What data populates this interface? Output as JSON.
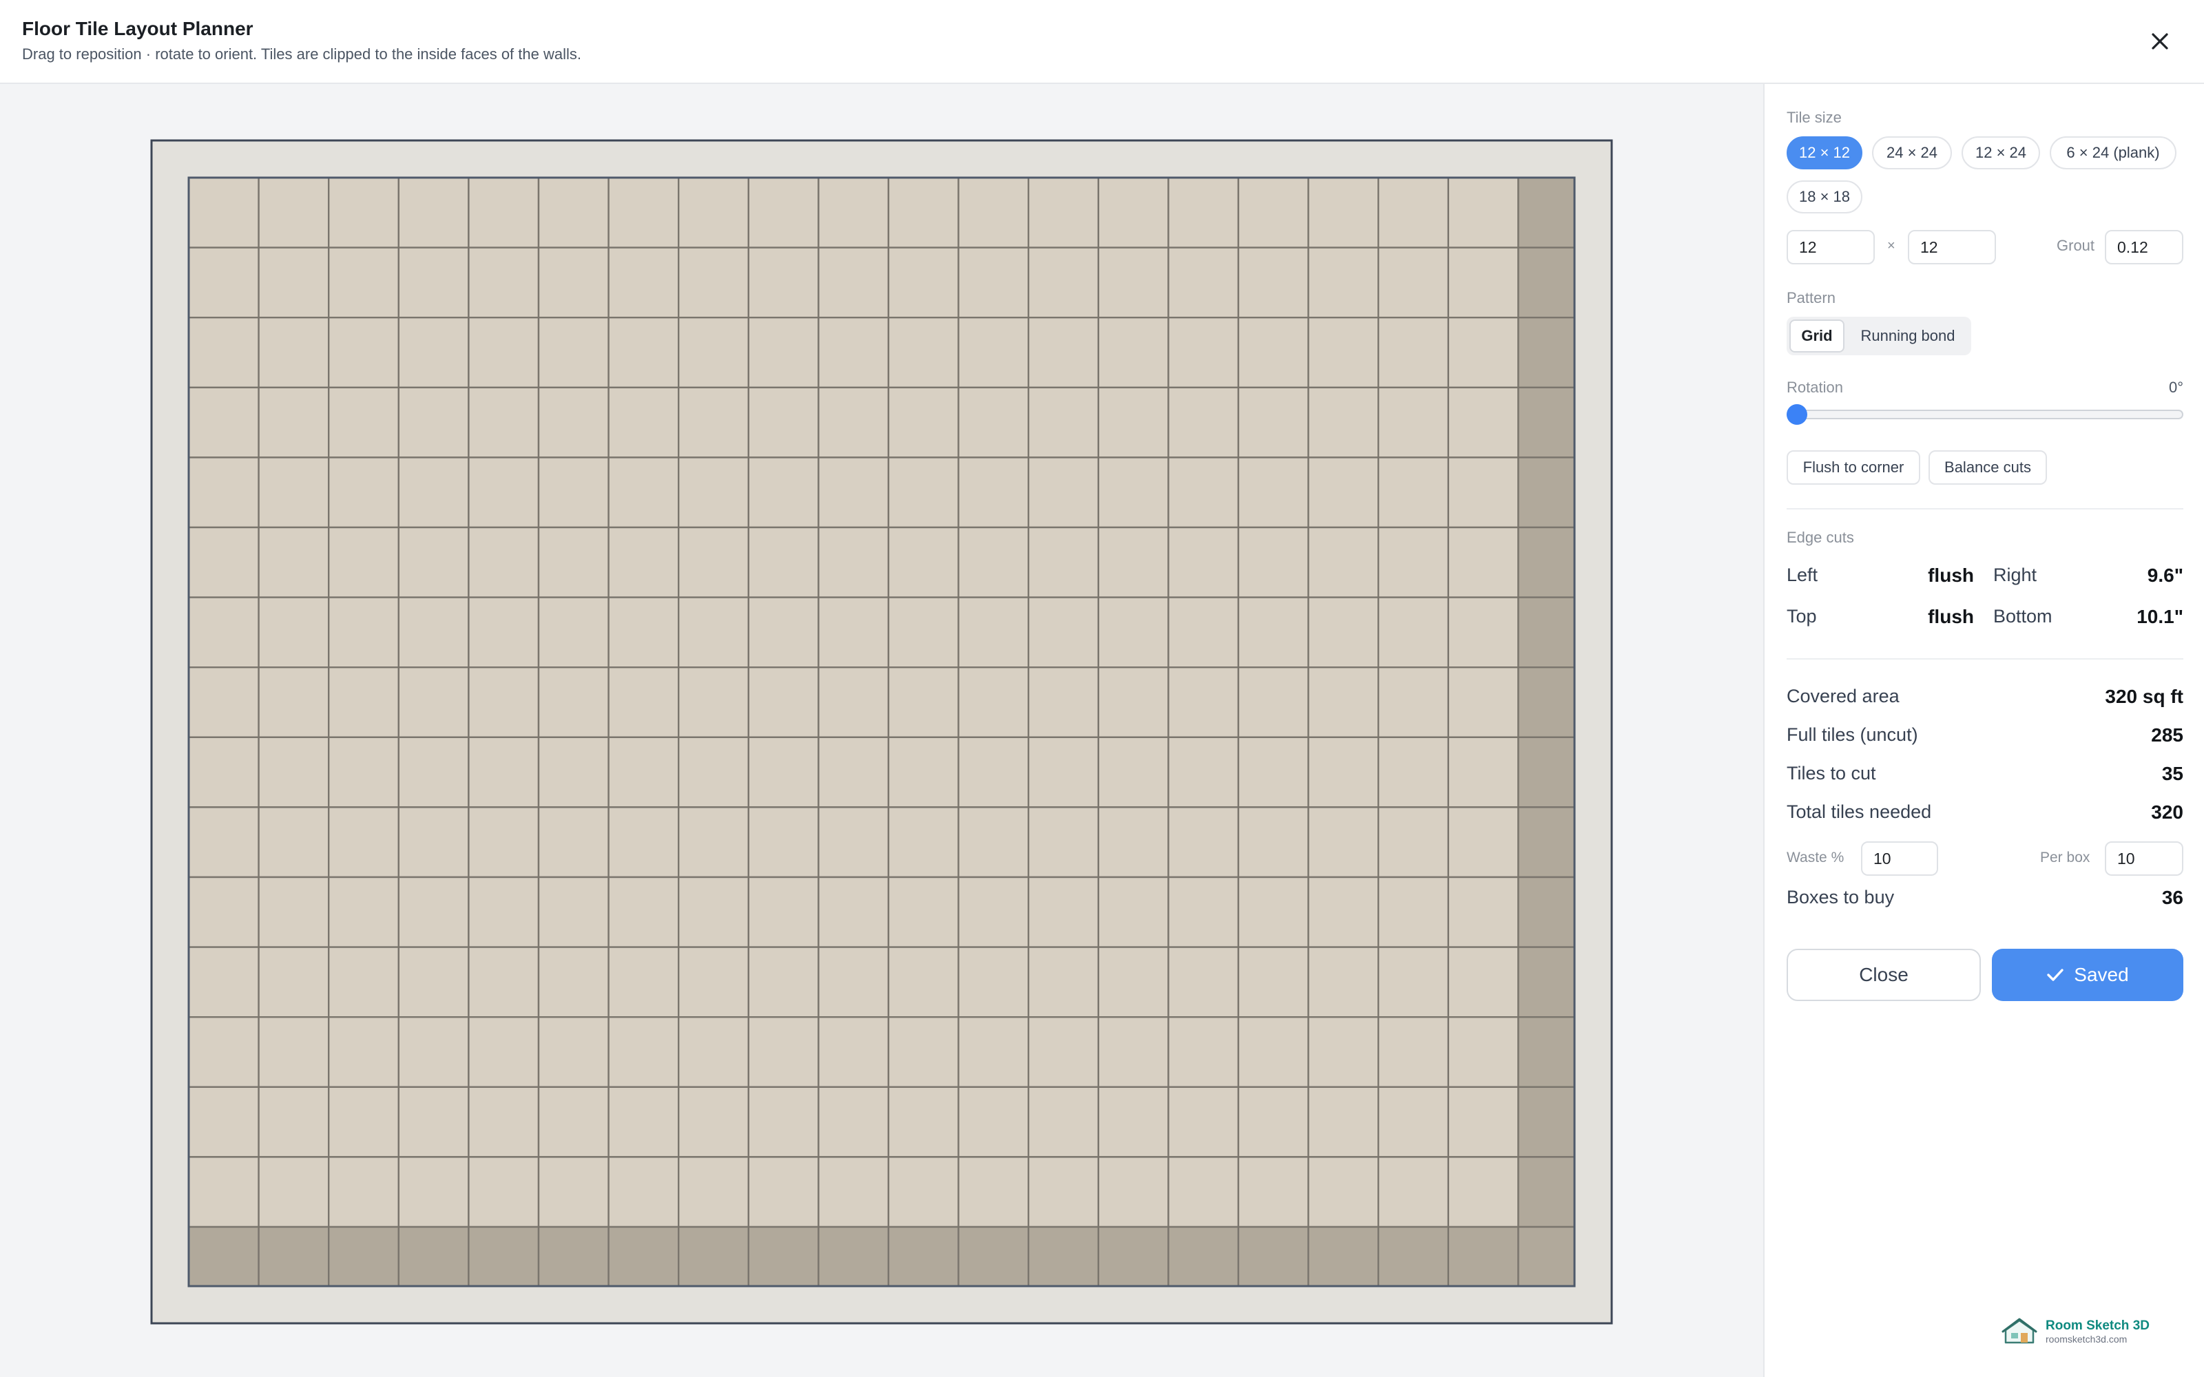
{
  "header": {
    "title": "Floor Tile Layout Planner",
    "subtitle": "Drag to reposition · rotate to orient. Tiles are clipped to the inside faces of the walls."
  },
  "canvas": {
    "columns": 20,
    "rows": 16,
    "colors": {
      "wall": "#e3e1dc",
      "wall_border": "#3d4656",
      "tile_full": "#d8d0c3",
      "tile_cut": "#b1a99b",
      "grout": "#7a756d"
    }
  },
  "panel": {
    "tile_size": {
      "label": "Tile size",
      "options": [
        "12 × 12",
        "24 × 24",
        "12 × 24",
        "6 × 24 (plank)",
        "18 × 18"
      ],
      "selected": "12 × 12",
      "width": "12",
      "height": "12",
      "times": "×",
      "grout_label": "Grout",
      "grout": "0.12"
    },
    "pattern": {
      "label": "Pattern",
      "options": [
        "Grid",
        "Running bond"
      ],
      "selected": "Grid"
    },
    "rotation": {
      "label": "Rotation",
      "value": "0°",
      "degrees": 0
    },
    "actions": {
      "flush": "Flush to corner",
      "balance": "Balance cuts"
    },
    "edge_cuts": {
      "label": "Edge cuts",
      "left_label": "Left",
      "left": "flush",
      "right_label": "Right",
      "right": "9.6\"",
      "top_label": "Top",
      "top": "flush",
      "bottom_label": "Bottom",
      "bottom": "10.1\""
    },
    "summary": {
      "covered_label": "Covered area",
      "covered": "320 sq ft",
      "full_label": "Full tiles (uncut)",
      "full": "285",
      "cut_label": "Tiles to cut",
      "cut": "35",
      "total_label": "Total tiles needed",
      "total": "320",
      "waste_label": "Waste %",
      "waste": "10",
      "per_box_label": "Per box",
      "per_box": "10",
      "boxes_label": "Boxes to buy",
      "boxes": "36"
    },
    "footer": {
      "close": "Close",
      "saved": "Saved"
    }
  },
  "brand": {
    "name": "Room Sketch 3D",
    "url": "roomsketch3d.com",
    "icon": "house-logo-icon"
  },
  "icons": {
    "close": "close-icon",
    "check": "check-icon"
  }
}
